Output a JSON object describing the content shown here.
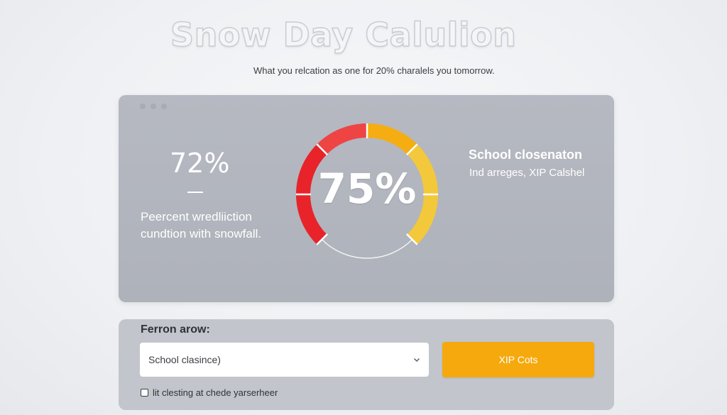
{
  "page": {
    "title": "Snow Day Calulion",
    "subtitle": "What you relcation as one for 20% charalels you tomorrow."
  },
  "prediction": {
    "left_value": "72%",
    "left_description": "Peercent wredliiction cundtion with snowfall.",
    "gauge_value": "75%",
    "gauge_level_percent": 75,
    "right_title": "School closenaton",
    "right_subtitle": "Ind arreges, XIP Calshel"
  },
  "form": {
    "label": "Ferron arow:",
    "select_value": "School clasince)",
    "button_label": "XIP Cots",
    "checkbox_label": "lit clesting at chede yarserheer",
    "checkbox_checked": false
  },
  "colors": {
    "accent": "#f6a90d",
    "gauge_red": "#e8232a",
    "gauge_orange": "#f6ad12",
    "gauge_yellow": "#f3c83a",
    "panel": "#b3b7bf"
  }
}
